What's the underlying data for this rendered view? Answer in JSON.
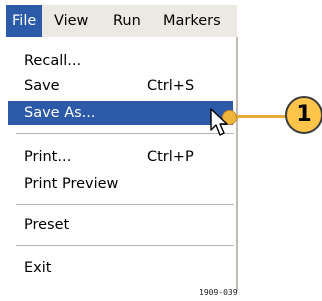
{
  "menubar": {
    "titles": [
      "File",
      "View",
      "Run",
      "Markers"
    ]
  },
  "file_menu": {
    "items": [
      {
        "label": "Recall...",
        "shortcut": ""
      },
      {
        "label": "Save",
        "shortcut": "Ctrl+S"
      },
      {
        "label": "Save As...",
        "shortcut": ""
      },
      {
        "label": "Print...",
        "shortcut": "Ctrl+P"
      },
      {
        "label": "Print Preview",
        "shortcut": ""
      },
      {
        "label": "Preset",
        "shortcut": ""
      },
      {
        "label": "Exit",
        "shortcut": ""
      }
    ],
    "highlighted_item": "Save As..."
  },
  "callout": {
    "number": "1"
  },
  "figure_id": "1909-039",
  "colors": {
    "menu_highlight": "#2c5aa8",
    "callout_fill": "#ffc54a",
    "callout_line": "#e8aa34",
    "menubar_bg": "#ebe9e2"
  },
  "icons": [
    "pointer-cursor-icon"
  ]
}
